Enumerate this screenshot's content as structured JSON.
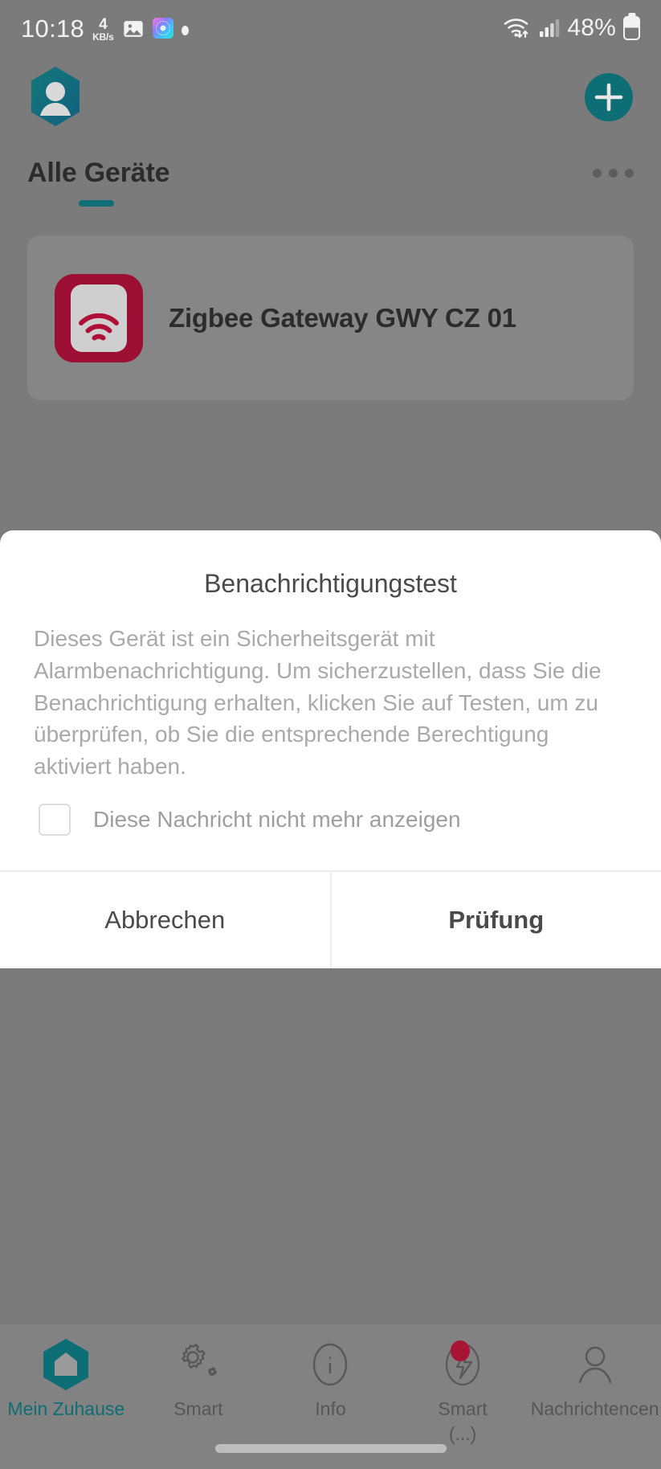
{
  "status_bar": {
    "time": "10:18",
    "network_speed_value": "4",
    "network_speed_unit": "KB/s",
    "gallery_icon": "image-icon",
    "app_badge_icon": "colorful-app-icon",
    "dot_icon": "dot-indicator-icon",
    "wifi_icon": "wifi-transfer-icon",
    "signal_icon": "cellular-signal-icon",
    "battery_percent": "48%",
    "battery_icon": "battery-icon"
  },
  "app_bar": {
    "profile_icon": "profile-hexagon-icon",
    "add_icon": "plus-circle-icon"
  },
  "section": {
    "title": "Alle Geräte",
    "overflow_icon": "more-options-icon"
  },
  "device": {
    "name": "Zigbee Gateway GWY CZ 01",
    "icon": "zigbee-gateway-signal-icon",
    "icon_color": "#9c0e33"
  },
  "dialog": {
    "title": "Benachrichtigungstest",
    "body": "Dieses Gerät ist ein Sicherheitsgerät mit Alarmbenachrichtigung. Um sicherzustellen, dass Sie die Benachrichtigung erhalten, klicken Sie auf Testen, um zu überprüfen, ob Sie die entsprechende Berechtigung aktiviert haben.",
    "checkbox_label": "Diese Nachricht nicht mehr anzeigen",
    "checkbox_checked": false,
    "cancel_label": "Abbrechen",
    "confirm_label": "Prüfung"
  },
  "bottom_nav": {
    "items": [
      {
        "label": "Mein Zuhause",
        "icon": "home-hexagon-icon",
        "active": true
      },
      {
        "label": "Smart",
        "icon": "gears-icon",
        "active": false
      },
      {
        "label": "Info",
        "icon": "info-circle-icon",
        "active": false
      },
      {
        "label": "Smart",
        "sublabel": "(...)",
        "icon": "lightning-circle-icon",
        "active": false,
        "badge": true
      },
      {
        "label": "Nachrichtencen",
        "icon": "person-icon",
        "active": false
      }
    ]
  },
  "colors": {
    "accent_teal": "#0d6e75",
    "device_red": "#9c0e33",
    "badge_red": "#a81433",
    "overlay_gray": "#7b7b7b"
  }
}
